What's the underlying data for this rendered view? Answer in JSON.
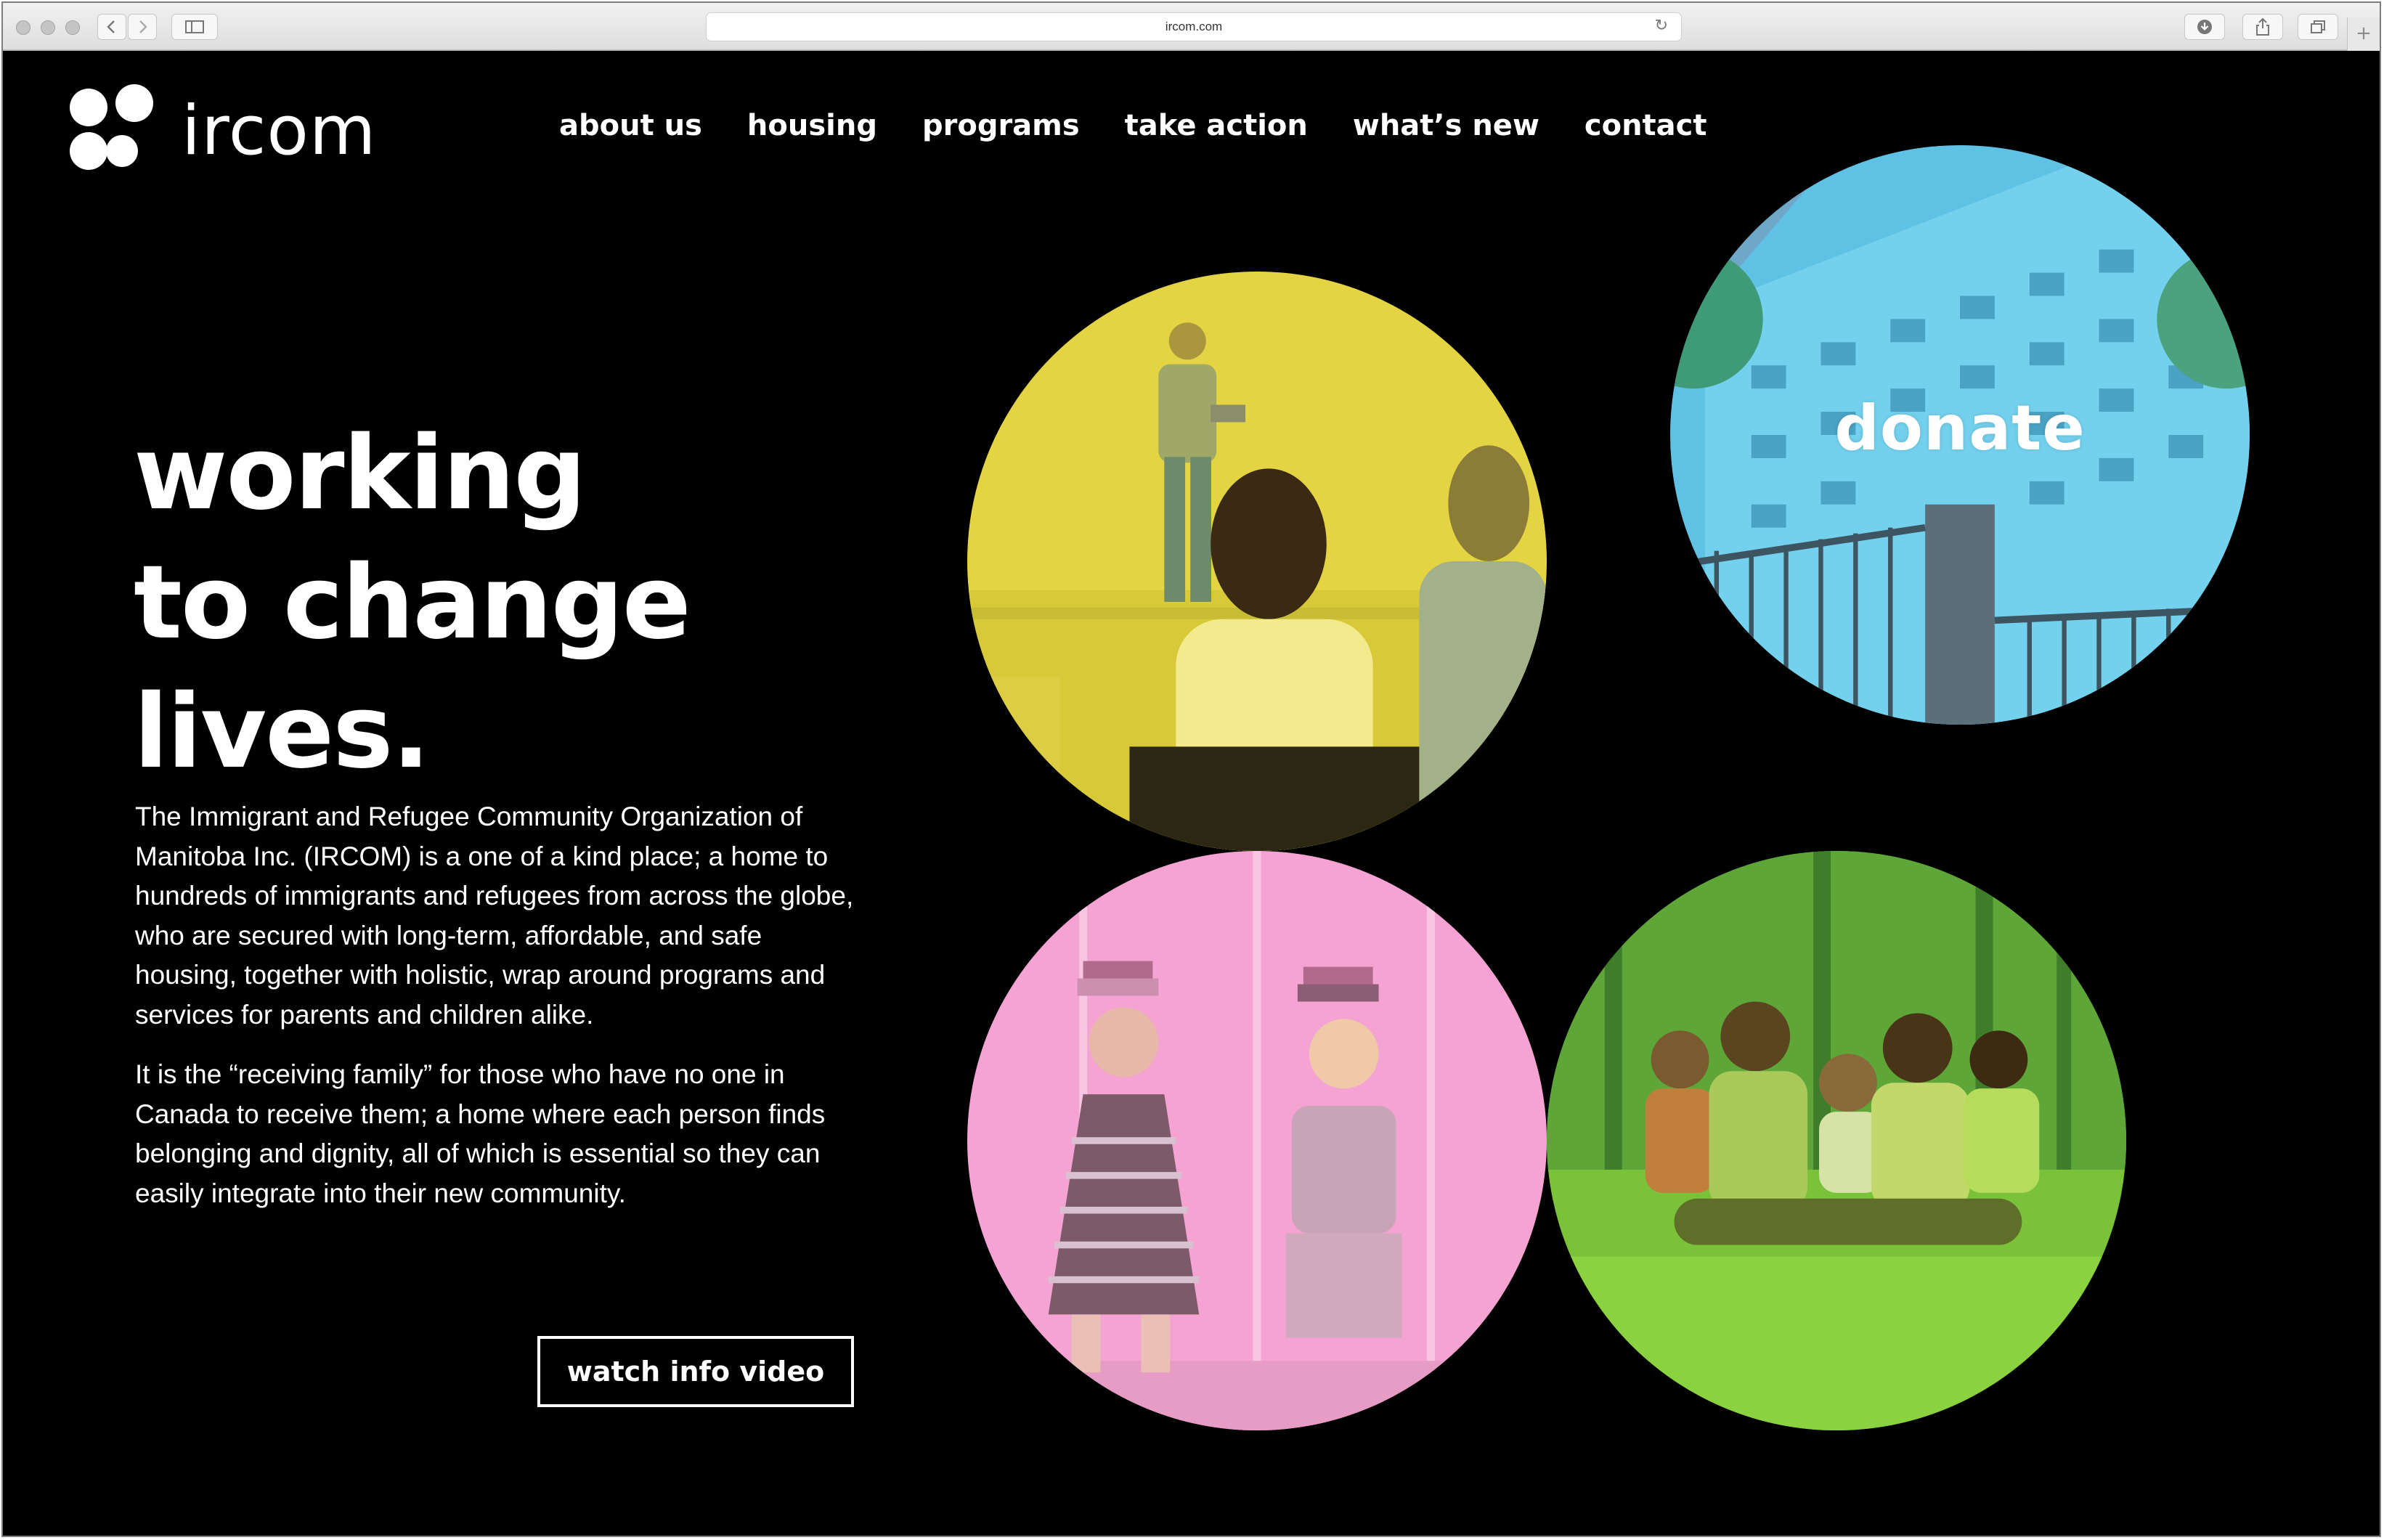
{
  "browser": {
    "url": "ircom.com"
  },
  "brand": {
    "name": "ircom",
    "colors": {
      "background": "#000000",
      "text": "#ffffff",
      "yellow": "#e6d23e",
      "blue": "#62c4e4",
      "pink": "#f59bd0",
      "green": "#86cf3a"
    }
  },
  "nav": {
    "items": [
      {
        "label": "about us"
      },
      {
        "label": "housing"
      },
      {
        "label": "programs"
      },
      {
        "label": "take action"
      },
      {
        "label": "what’s new"
      },
      {
        "label": "contact"
      }
    ]
  },
  "hero": {
    "headline_lines": [
      "working",
      "to change",
      "lives."
    ],
    "paragraphs": [
      "The Immigrant and Refugee Community Organization of Manitoba Inc. (IRCOM) is a one of a kind place; a home to hundreds of immigrants and refugees from across the globe, who are secured with long-term, affordable, and safe housing, together with holistic, wrap around programs and services for parents and children alike.",
      "It is the “receiving family” for those who have no one in Canada to receive them; a home where each person finds belonging and dignity, all of which is essential so they can easily integrate into their new community."
    ],
    "video_button": "watch info video"
  },
  "tiles": {
    "donate_label": "donate"
  }
}
